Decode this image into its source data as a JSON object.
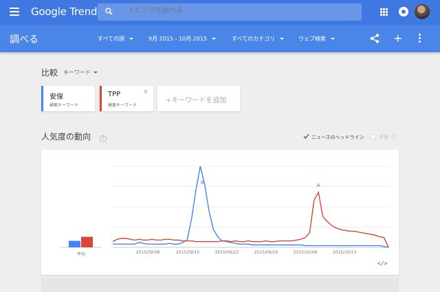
{
  "app": {
    "logo_text": "Google Trends",
    "accent": "#3f78e0",
    "subbar_color": "#4a86e8"
  },
  "search": {
    "placeholder": "トピックを調べる"
  },
  "subbar": {
    "page_title": "調べる",
    "filters": [
      {
        "label": "すべての国"
      },
      {
        "label": "9月 2015 - 10月 2015"
      },
      {
        "label": "すべてのカテゴリ"
      },
      {
        "label": "ウェブ検索"
      }
    ],
    "icons": [
      "share-icon",
      "plus-icon",
      "more-vert-icon"
    ]
  },
  "compare": {
    "title": "比較",
    "mode": "キーワード",
    "keywords": [
      {
        "term": "安保",
        "type": "検索キーワード",
        "color": "#4285f4"
      },
      {
        "term": "TPP",
        "type": "検索キーワード",
        "color": "#db4437",
        "close": "×"
      }
    ],
    "add_label": "+キーワードを追加"
  },
  "interest": {
    "title": "人気度の動向",
    "help": "?",
    "news_label": "ニュースのヘッドライン",
    "news_checked": true,
    "forecast_label": "予測",
    "forecast_checked": false
  },
  "chart_data": {
    "type": "line",
    "average_label": "平均",
    "average_values": [
      8,
      13
    ],
    "x_tick_labels": [
      "2015/09/08",
      "2015/09/15",
      "2015/09/22",
      "2015/09/29",
      "2015/10/06",
      "2015/10/13"
    ],
    "ylim": [
      0,
      100
    ],
    "series": [
      {
        "name": "安保",
        "color": "#4285f4",
        "values": [
          4,
          4,
          4,
          4,
          4,
          4,
          6,
          5,
          4,
          4,
          4,
          4,
          4,
          5,
          4,
          4,
          6,
          9,
          35,
          70,
          100,
          78,
          45,
          22,
          13,
          8,
          7,
          6,
          5,
          4,
          4,
          4,
          3,
          3,
          3,
          3,
          3,
          3,
          3,
          3,
          3,
          3,
          3,
          3,
          2,
          2,
          2,
          2,
          2,
          2,
          2,
          2,
          2,
          2,
          2,
          2,
          2,
          2,
          2,
          2,
          2,
          2,
          1,
          0
        ]
      },
      {
        "name": "TPP",
        "color": "#db4437",
        "values": [
          7,
          10,
          11,
          11,
          10,
          9,
          10,
          9,
          9,
          10,
          9,
          9,
          10,
          10,
          9,
          9,
          8,
          8,
          8,
          7,
          7,
          7,
          7,
          7,
          7,
          8,
          8,
          7,
          8,
          7,
          7,
          8,
          7,
          7,
          7,
          8,
          7,
          7,
          8,
          8,
          8,
          8,
          9,
          10,
          12,
          18,
          58,
          68,
          38,
          32,
          27,
          24,
          22,
          21,
          20,
          20,
          19,
          18,
          17,
          16,
          15,
          13,
          12,
          0
        ]
      }
    ],
    "annotations": [
      {
        "letter": "B",
        "series": 0,
        "index": 20
      },
      {
        "letter": "A",
        "series": 1,
        "index": 47
      }
    ]
  },
  "embed_label": "</>"
}
